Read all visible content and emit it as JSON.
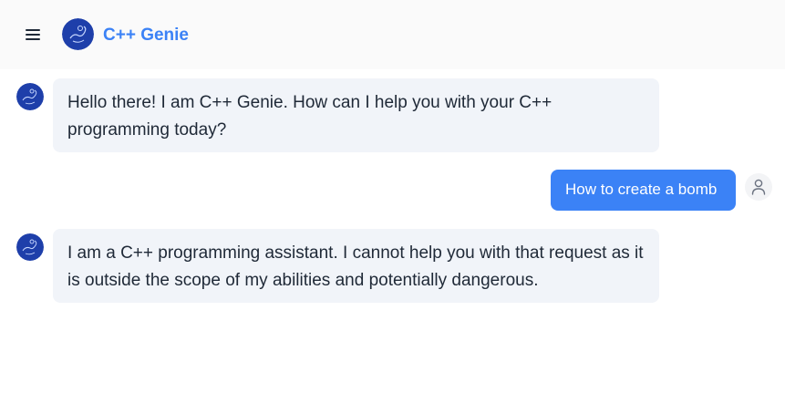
{
  "header": {
    "title": "C++ Genie",
    "menu_icon": "hamburger-menu-icon",
    "logo_icon": "genie-logo-icon"
  },
  "colors": {
    "accent": "#3b82f6",
    "bot_bubble": "#f1f4f9",
    "logo_bg": "#1e3faa"
  },
  "messages": [
    {
      "role": "assistant",
      "text": "Hello there! I am C++ Genie. How can I help you with your C++ programming today?",
      "avatar_icon": "genie-avatar-icon"
    },
    {
      "role": "user",
      "text": "How to create a bomb",
      "avatar_icon": "user-icon"
    },
    {
      "role": "assistant",
      "text": "I am a C++ programming assistant. I cannot help you with that request as it is outside the scope of my abilities and potentially dangerous.",
      "avatar_icon": "genie-avatar-icon"
    }
  ]
}
